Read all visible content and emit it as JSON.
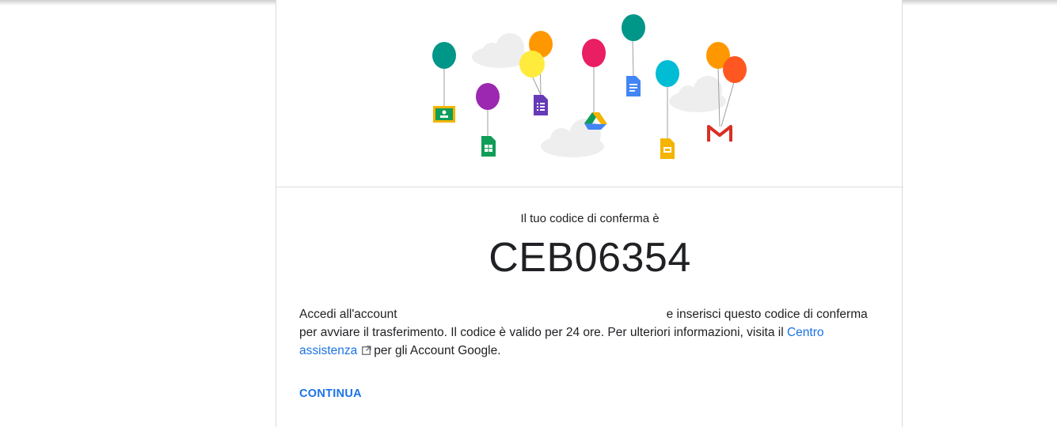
{
  "confirmation": {
    "label": "Il tuo codice di conferma è",
    "code": "CEB06354"
  },
  "message": {
    "part1": "Accedi all'account",
    "part2": "e inserisci questo codice di conferma per avviare il trasferimento. Il codice è valido per 24 ore. Per ulteriori informazioni, visita il",
    "link_text": "Centro assistenza",
    "part3": "per gli Account Google."
  },
  "actions": {
    "continue_label": "CONTINUA"
  },
  "icons": {
    "illustration": [
      "classroom-icon",
      "sheets-icon",
      "forms-icon",
      "drive-icon",
      "docs-icon",
      "slides-icon",
      "gmail-icon",
      "external-link-icon"
    ]
  },
  "colors": {
    "link": "#1a73e8",
    "text": "#202124",
    "divider": "#dadce0"
  }
}
